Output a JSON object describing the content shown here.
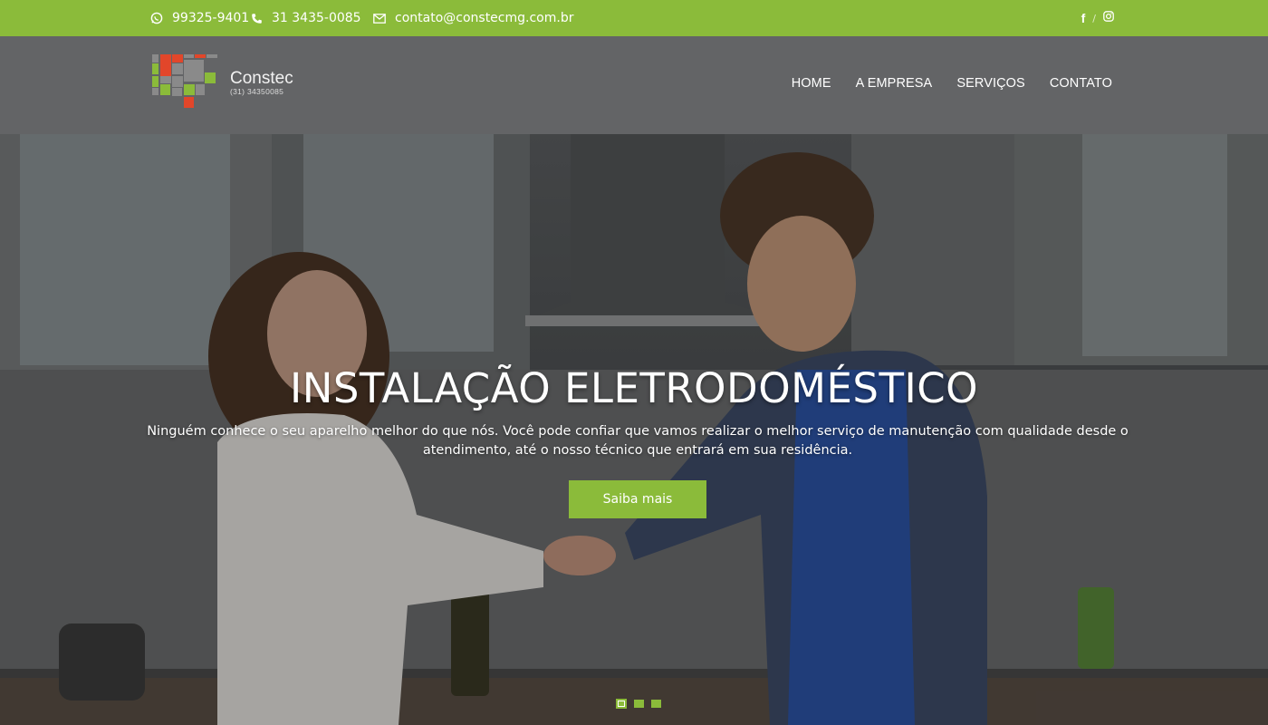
{
  "topbar": {
    "whatsapp": "99325-9401",
    "phone": "31 3435-0085",
    "email": "contato@constecmg.com.br",
    "social": {
      "facebook": "f",
      "separator": "/"
    }
  },
  "logo": {
    "brand": "Constec",
    "phone": "(31) 34350085"
  },
  "nav": {
    "items": [
      "HOME",
      "A EMPRESA",
      "SERVIÇOS",
      "CONTATO"
    ]
  },
  "hero": {
    "title": "INSTALAÇÃO ELETRODOMÉSTICO",
    "description": "Ninguém conhece o seu aparelho melhor do que nós. Você pode confiar que vamos realizar o melhor serviço de manutenção com qualidade desde o atendimento, até o nosso técnico que entrará em sua residência.",
    "cta": "Saiba mais",
    "slides": 3,
    "active_slide": 1
  },
  "colors": {
    "accent": "#8bbb3a",
    "header": "#636466",
    "logo_red": "#e2462a",
    "logo_gray": "#8a8a8a"
  }
}
